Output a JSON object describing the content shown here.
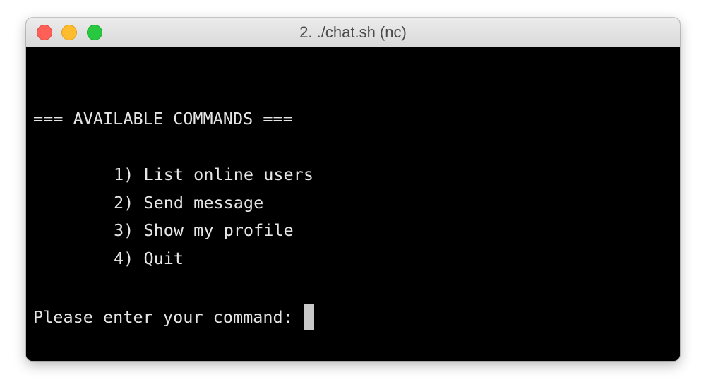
{
  "window": {
    "title": "2. ./chat.sh (nc)"
  },
  "terminal": {
    "header": "=== AVAILABLE COMMANDS ===",
    "commands": [
      "1) List online users",
      "2) Send message",
      "3) Show my profile",
      "4) Quit"
    ],
    "prompt": "Please enter your command: "
  },
  "colors": {
    "background": "#000000",
    "foreground": "#e6e6e6",
    "cursor": "#c8c8c8"
  }
}
